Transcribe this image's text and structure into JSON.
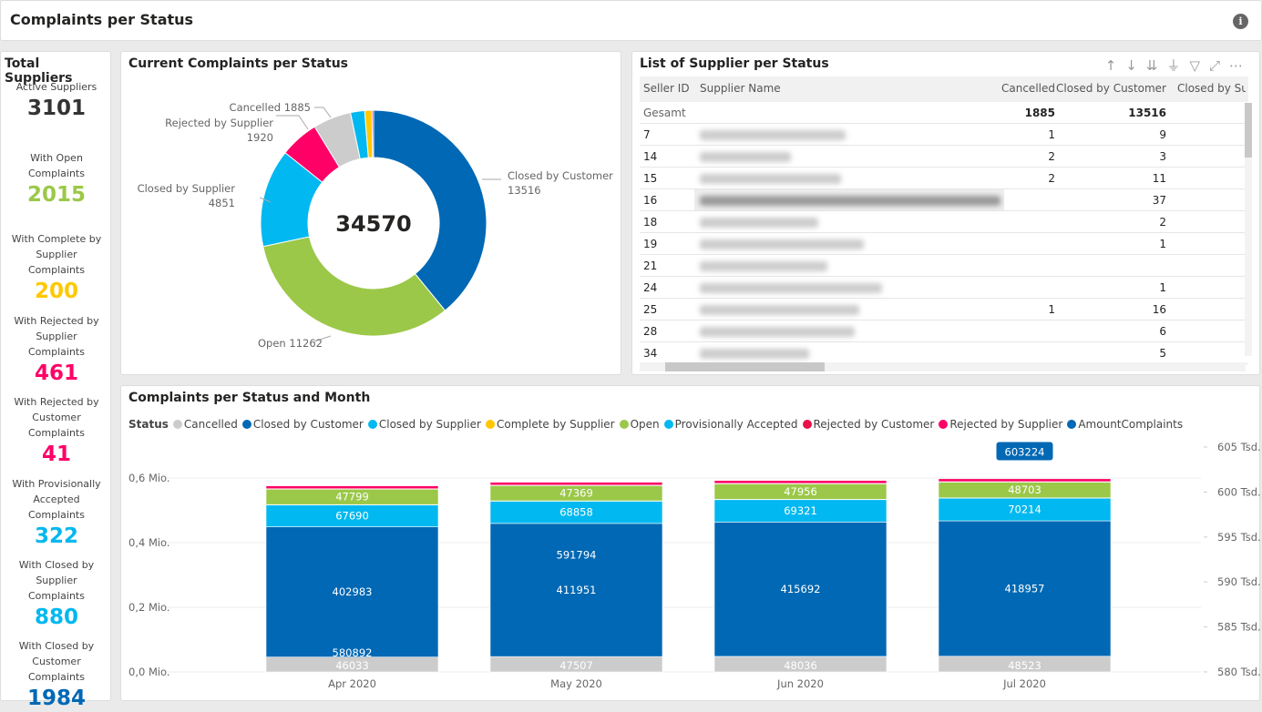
{
  "header": {
    "title": "Complaints per Status",
    "info_icon": "info-icon"
  },
  "left": {
    "title": "Total Suppliers",
    "kpis": [
      {
        "label": "Active Suppliers",
        "value": "3101",
        "color": "#333333"
      },
      {
        "label": "With Open Complaints",
        "value": "2015",
        "color": "#9bc848"
      },
      {
        "label": "With Complete by Supplier Complaints",
        "value": "200",
        "color": "#ffc800"
      },
      {
        "label": "With Rejected by Supplier Complaints",
        "value": "461",
        "color": "#ff0066"
      },
      {
        "label": "With Rejected by Customer Complaints",
        "value": "41",
        "color": "#ff0066"
      },
      {
        "label": "With Provisionally Accepted Complaints",
        "value": "322",
        "color": "#01b8f0"
      },
      {
        "label": "With Closed by Supplier Complaints",
        "value": "880",
        "color": "#01b8f0"
      },
      {
        "label": "With Closed by Customer Complaints",
        "value": "1984",
        "color": "#0068b4"
      }
    ]
  },
  "donut": {
    "title": "Current Complaints per Status",
    "total": "34570",
    "chart_data": {
      "type": "pie",
      "slices": [
        {
          "name": "Closed by Customer",
          "value": 13516,
          "color": "#0068b4",
          "label": "Closed by Customer 13516"
        },
        {
          "name": "Open",
          "value": 11262,
          "color": "#9bc848",
          "label": "Open 11262"
        },
        {
          "name": "Closed by Supplier",
          "value": 4851,
          "color": "#01b8f0",
          "label": "Closed by Supplier 4851"
        },
        {
          "name": "Rejected by Supplier",
          "value": 1920,
          "color": "#ff0066",
          "label": "Rejected by Supplier 1920"
        },
        {
          "name": "Cancelled",
          "value": 1885,
          "color": "#cccccc",
          "label": "Cancelled 1885"
        },
        {
          "name": "Provisionally Accepted",
          "value": 700,
          "color": "#01b8f0"
        },
        {
          "name": "Complete by Supplier",
          "value": 356,
          "color": "#ffc800"
        },
        {
          "name": "Rejected by Customer",
          "value": 80,
          "color": "#e8114a"
        }
      ]
    }
  },
  "table": {
    "title": "List of Supplier per Status",
    "columns": [
      "Seller ID",
      "Supplier Name",
      "Cancelled",
      "Closed by Customer",
      "Closed by Sup"
    ],
    "total": {
      "label": "Gesamt",
      "cancelled": "1885",
      "closed_by_customer": "13516"
    },
    "rows": [
      {
        "id": "7",
        "cancelled": "1",
        "cbc": "9"
      },
      {
        "id": "14",
        "cancelled": "2",
        "cbc": "3"
      },
      {
        "id": "15",
        "cancelled": "2",
        "cbc": "11"
      },
      {
        "id": "16",
        "cancelled": "",
        "cbc": "37"
      },
      {
        "id": "18",
        "cancelled": "",
        "cbc": "2"
      },
      {
        "id": "19",
        "cancelled": "",
        "cbc": "1"
      },
      {
        "id": "21",
        "cancelled": "",
        "cbc": ""
      },
      {
        "id": "24",
        "cancelled": "",
        "cbc": "1"
      },
      {
        "id": "25",
        "cancelled": "1",
        "cbc": "16"
      },
      {
        "id": "28",
        "cancelled": "",
        "cbc": "6"
      },
      {
        "id": "34",
        "cancelled": "",
        "cbc": "5"
      }
    ]
  },
  "bars": {
    "title": "Complaints per Status and Month",
    "legend_title": "Status",
    "legend": [
      {
        "name": "Cancelled",
        "color": "#cccccc"
      },
      {
        "name": "Closed by Customer",
        "color": "#0068b4"
      },
      {
        "name": "Closed by Supplier",
        "color": "#01b8f0"
      },
      {
        "name": "Complete by Supplier",
        "color": "#ffc800"
      },
      {
        "name": "Open",
        "color": "#9bc848"
      },
      {
        "name": "Provisionally Accepted",
        "color": "#01b8f0"
      },
      {
        "name": "Rejected by Customer",
        "color": "#e8114a"
      },
      {
        "name": "Rejected by Supplier",
        "color": "#ff0066"
      },
      {
        "name": "AmountComplaints",
        "color": "#0068b4"
      }
    ],
    "chart_data": {
      "type": "bar",
      "stacked": true,
      "categories": [
        "Apr 2020",
        "May 2020",
        "Jun 2020",
        "Jul 2020"
      ],
      "ylim": [
        0,
        0.6
      ],
      "yticks": [
        "0,0 Mio.",
        "0,2 Mio.",
        "0,4 Mio.",
        "0,6 Mio."
      ],
      "ytick_values": [
        0,
        0.2,
        0.4,
        0.6
      ],
      "y2lim": [
        580,
        605
      ],
      "y2ticks": [
        "580 Tsd.",
        "585 Tsd.",
        "590 Tsd.",
        "595 Tsd.",
        "600 Tsd.",
        "605 Tsd."
      ],
      "y2tick_values": [
        580,
        585,
        590,
        595,
        600,
        605
      ],
      "series": [
        {
          "name": "Cancelled",
          "color": "#cccccc",
          "values": [
            46033,
            47507,
            48036,
            48523
          ],
          "labels": true
        },
        {
          "name": "Closed by Customer",
          "color": "#0068b4",
          "values": [
            402983,
            411951,
            415692,
            418957
          ],
          "labels": true
        },
        {
          "name": "Closed by Supplier",
          "color": "#01b8f0",
          "values": [
            67690,
            68858,
            69321,
            70214
          ],
          "labels": true
        },
        {
          "name": "Complete by Supplier",
          "color": "#ffc800",
          "values": [
            1000,
            1000,
            1000,
            1000
          ]
        },
        {
          "name": "Open",
          "color": "#9bc848",
          "values": [
            47799,
            47369,
            47956,
            48703
          ],
          "labels": true
        },
        {
          "name": "Provisionally Accepted",
          "color": "#01b8f0",
          "values": [
            800,
            800,
            800,
            800
          ]
        },
        {
          "name": "Rejected by Customer",
          "color": "#e8114a",
          "values": [
            500,
            500,
            500,
            500
          ]
        },
        {
          "name": "Rejected by Supplier",
          "color": "#ff0066",
          "values": [
            9000,
            9000,
            9000,
            9000
          ]
        }
      ],
      "line": {
        "name": "AmountComplaints",
        "values": [
          580892,
          591794,
          null,
          603224
        ]
      }
    }
  }
}
